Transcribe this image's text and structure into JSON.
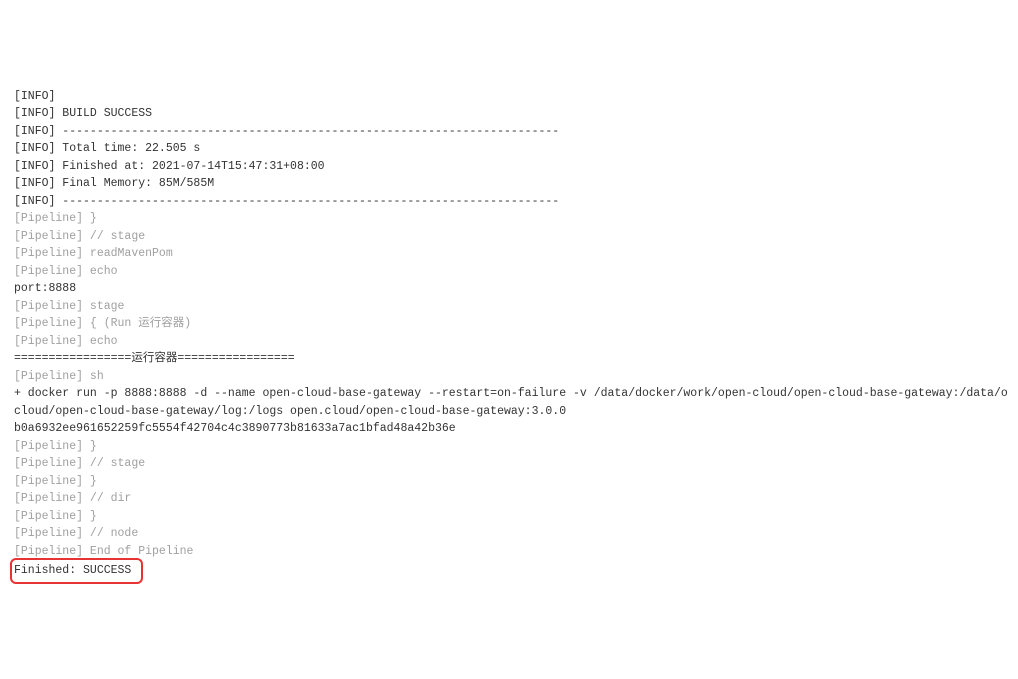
{
  "lines": [
    {
      "cls": "normal",
      "text": "[INFO] "
    },
    {
      "cls": "normal",
      "text": "[INFO] BUILD SUCCESS"
    },
    {
      "cls": "normal",
      "text": "[INFO] ------------------------------------------------------------------------"
    },
    {
      "cls": "normal",
      "text": "[INFO] Total time: 22.505 s"
    },
    {
      "cls": "normal",
      "text": "[INFO] Finished at: 2021-07-14T15:47:31+08:00"
    },
    {
      "cls": "normal",
      "text": "[INFO] Final Memory: 85M/585M"
    },
    {
      "cls": "normal",
      "text": "[INFO] ------------------------------------------------------------------------"
    },
    {
      "cls": "dim",
      "text": "[Pipeline] }"
    },
    {
      "cls": "dim",
      "text": "[Pipeline] // stage"
    },
    {
      "cls": "dim",
      "text": "[Pipeline] readMavenPom"
    },
    {
      "cls": "dim",
      "text": "[Pipeline] echo"
    },
    {
      "cls": "normal",
      "text": "port:8888"
    },
    {
      "cls": "dim",
      "text": "[Pipeline] stage"
    },
    {
      "cls": "dim",
      "text": "[Pipeline] { (Run 运行容器)"
    },
    {
      "cls": "dim",
      "text": "[Pipeline] echo"
    },
    {
      "cls": "normal",
      "text": "=================运行容器================="
    },
    {
      "cls": "dim",
      "text": "[Pipeline] sh"
    },
    {
      "cls": "normal",
      "text": "+ docker run -p 8888:8888 -d --name open-cloud-base-gateway --restart=on-failure -v /data/docker/work/open-cloud/open-cloud-base-gateway:/data/o"
    },
    {
      "cls": "normal",
      "text": "cloud/open-cloud-base-gateway/log:/logs open.cloud/open-cloud-base-gateway:3.0.0"
    },
    {
      "cls": "normal",
      "text": "b0a6932ee961652259fc5554f42704c4c3890773b81633a7ac1bfad48a42b36e"
    },
    {
      "cls": "dim",
      "text": "[Pipeline] }"
    },
    {
      "cls": "dim",
      "text": "[Pipeline] // stage"
    },
    {
      "cls": "dim",
      "text": "[Pipeline] }"
    },
    {
      "cls": "dim",
      "text": "[Pipeline] // dir"
    },
    {
      "cls": "dim",
      "text": "[Pipeline] }"
    },
    {
      "cls": "dim",
      "text": "[Pipeline] // node"
    },
    {
      "cls": "dim",
      "text": "[Pipeline] End of Pipeline"
    }
  ],
  "finished": "Finished: SUCCESS"
}
